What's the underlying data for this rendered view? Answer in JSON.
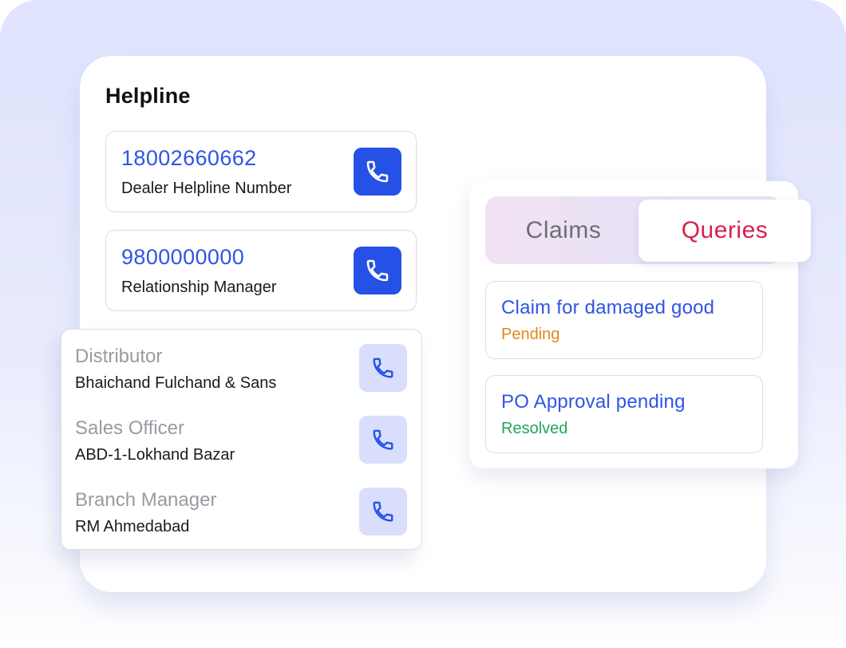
{
  "helpline": {
    "title": "Helpline",
    "entries": [
      {
        "number": "18002660662",
        "label": "Dealer Helpline Number"
      },
      {
        "number": "9800000000",
        "label": "Relationship Manager"
      }
    ]
  },
  "contacts": [
    {
      "role": "Distributor",
      "name": "Bhaichand Fulchand & Sans"
    },
    {
      "role": "Sales Officer",
      "name": "ABD-1-Lokhand Bazar"
    },
    {
      "role": "Branch Manager",
      "name": "RM Ahmedabad"
    }
  ],
  "tabs": {
    "claims_label": "Claims",
    "queries_label": "Queries",
    "selected": "Queries"
  },
  "tickets": [
    {
      "title": "Claim for damaged good",
      "status": "Pending",
      "status_color": "#e3871b"
    },
    {
      "title": "PO Approval pending",
      "status": "Resolved",
      "status_color": "#22a55a"
    }
  ],
  "colors": {
    "accent": "#2551e6",
    "number_text": "#2f55e4",
    "queries_tab": "#db1f4b",
    "call_button_light": "#d8defc"
  },
  "icons": {
    "call": "phone-icon"
  }
}
